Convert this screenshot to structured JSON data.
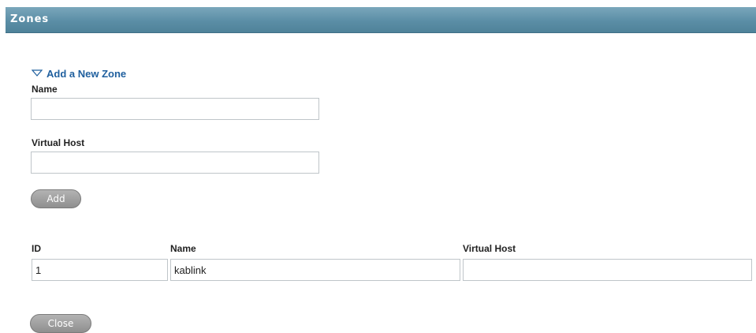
{
  "header": {
    "title": "Zones"
  },
  "add_zone": {
    "toggle_label": "Add a New Zone",
    "name_label": "Name",
    "name_value": "",
    "virtual_host_label": "Virtual Host",
    "virtual_host_value": "",
    "add_button": "Add"
  },
  "zones_table": {
    "columns": [
      "ID",
      "Name",
      "Virtual Host"
    ],
    "rows": [
      {
        "id": "1",
        "name": "kablink",
        "virtual_host": ""
      }
    ]
  },
  "footer": {
    "close_button": "Close"
  },
  "colors": {
    "titlebar": "#5b8ea6",
    "link": "#1f5f9e",
    "button": "#a0a0a0"
  }
}
